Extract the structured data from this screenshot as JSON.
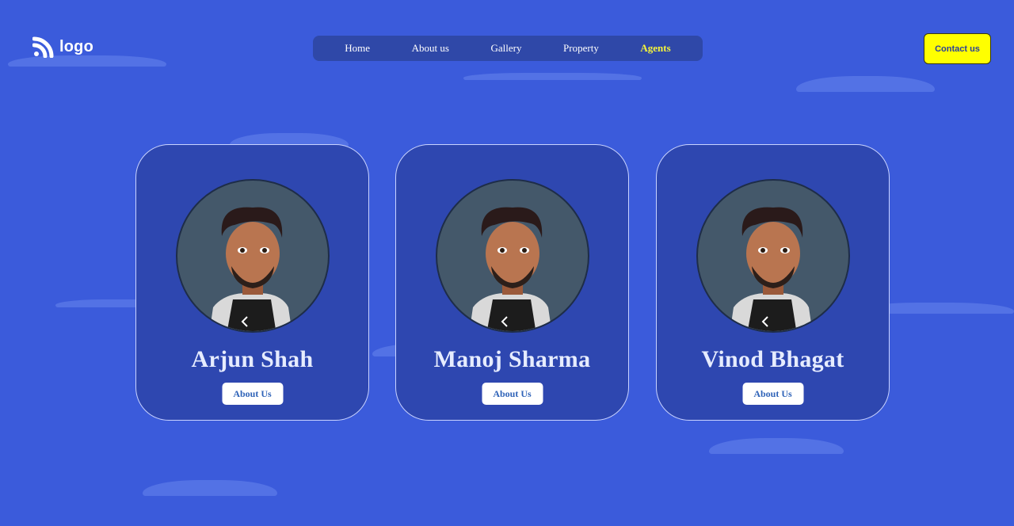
{
  "header": {
    "logo_text": "logo",
    "nav": [
      {
        "label": "Home",
        "active": false
      },
      {
        "label": "About us",
        "active": false
      },
      {
        "label": "Gallery",
        "active": false
      },
      {
        "label": "Property",
        "active": false
      },
      {
        "label": "Agents",
        "active": true
      }
    ],
    "contact_label": "Contact us"
  },
  "agents": [
    {
      "name": "Arjun Shah",
      "button_label": "About Us"
    },
    {
      "name": "Manoj Sharma",
      "button_label": "About Us"
    },
    {
      "name": "Vinod Bhagat",
      "button_label": "About Us"
    }
  ],
  "colors": {
    "background": "#3b5bdb",
    "nav_background": "#2f48a8",
    "active_nav": "#f5f53a",
    "contact_button": "#ffff00",
    "card_background": "#2e47b0"
  }
}
